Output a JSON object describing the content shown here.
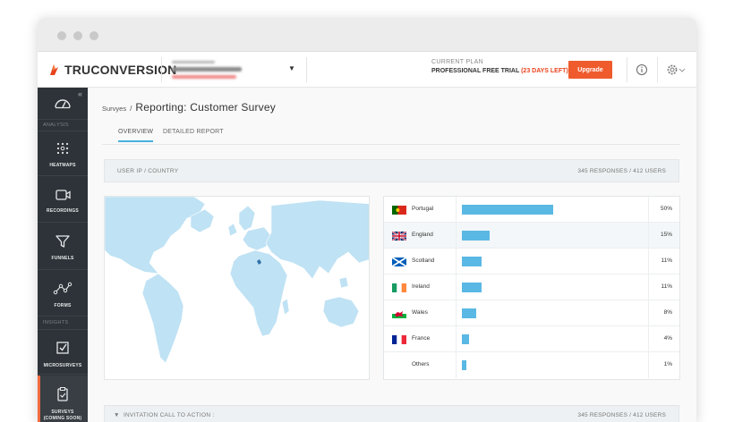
{
  "app": {
    "logo_text": "TRUCONVERSION"
  },
  "topbar": {
    "plan_label": "CURRENT PLAN",
    "plan_name": "PROFESSIONAL FREE TRIAL",
    "plan_days": "(23 DAYS LEFT)",
    "upgrade_label": "Upgrade"
  },
  "sidebar": {
    "sections": {
      "analysis": "ANALYSIS",
      "insights": "INSIGHTS"
    },
    "items": [
      {
        "label": "HEATMAPS",
        "icon": "heatmaps-icon"
      },
      {
        "label": "RECORDINGS",
        "icon": "recordings-icon"
      },
      {
        "label": "FUNNELS",
        "icon": "funnels-icon"
      },
      {
        "label": "FORMS",
        "icon": "forms-icon"
      },
      {
        "label": "MICROSURVEYS",
        "icon": "microsurveys-icon"
      },
      {
        "label": "SURVEYS",
        "sublabel": "(COMING SOON)",
        "icon": "surveys-icon"
      }
    ]
  },
  "breadcrumb": {
    "parent": "Survyes",
    "separator": "/",
    "title": "Reporting: Customer Survey"
  },
  "tabs": [
    {
      "label": "OVERVIEW",
      "active": true
    },
    {
      "label": "DETAILED REPORT",
      "active": false
    }
  ],
  "panel": {
    "title": "USER IP / COUNTRY",
    "stats": "345 RESPONSES / 412 USERS"
  },
  "countries": [
    {
      "name": "Portugal",
      "percent": "50%",
      "value": 50,
      "flag": "portugal"
    },
    {
      "name": "England",
      "percent": "15%",
      "value": 15,
      "flag": "england"
    },
    {
      "name": "Scotland",
      "percent": "11%",
      "value": 11,
      "flag": "scotland"
    },
    {
      "name": "Ireland",
      "percent": "11%",
      "value": 11,
      "flag": "ireland"
    },
    {
      "name": "Wales",
      "percent": "8%",
      "value": 8,
      "flag": "wales"
    },
    {
      "name": "France",
      "percent": "4%",
      "value": 4,
      "flag": "france"
    },
    {
      "name": "Others",
      "percent": "1%",
      "value": 1,
      "flag": "none"
    }
  ],
  "panel2": {
    "title": "INVITATION CALL TO ACTION :",
    "stats": "345 RESPONSES / 412 USERS"
  },
  "colors": {
    "accent": "#ef5b2c",
    "bar": "#5ab8e4",
    "sidebar": "#2d3338",
    "tab_underline": "#48b0e2"
  }
}
